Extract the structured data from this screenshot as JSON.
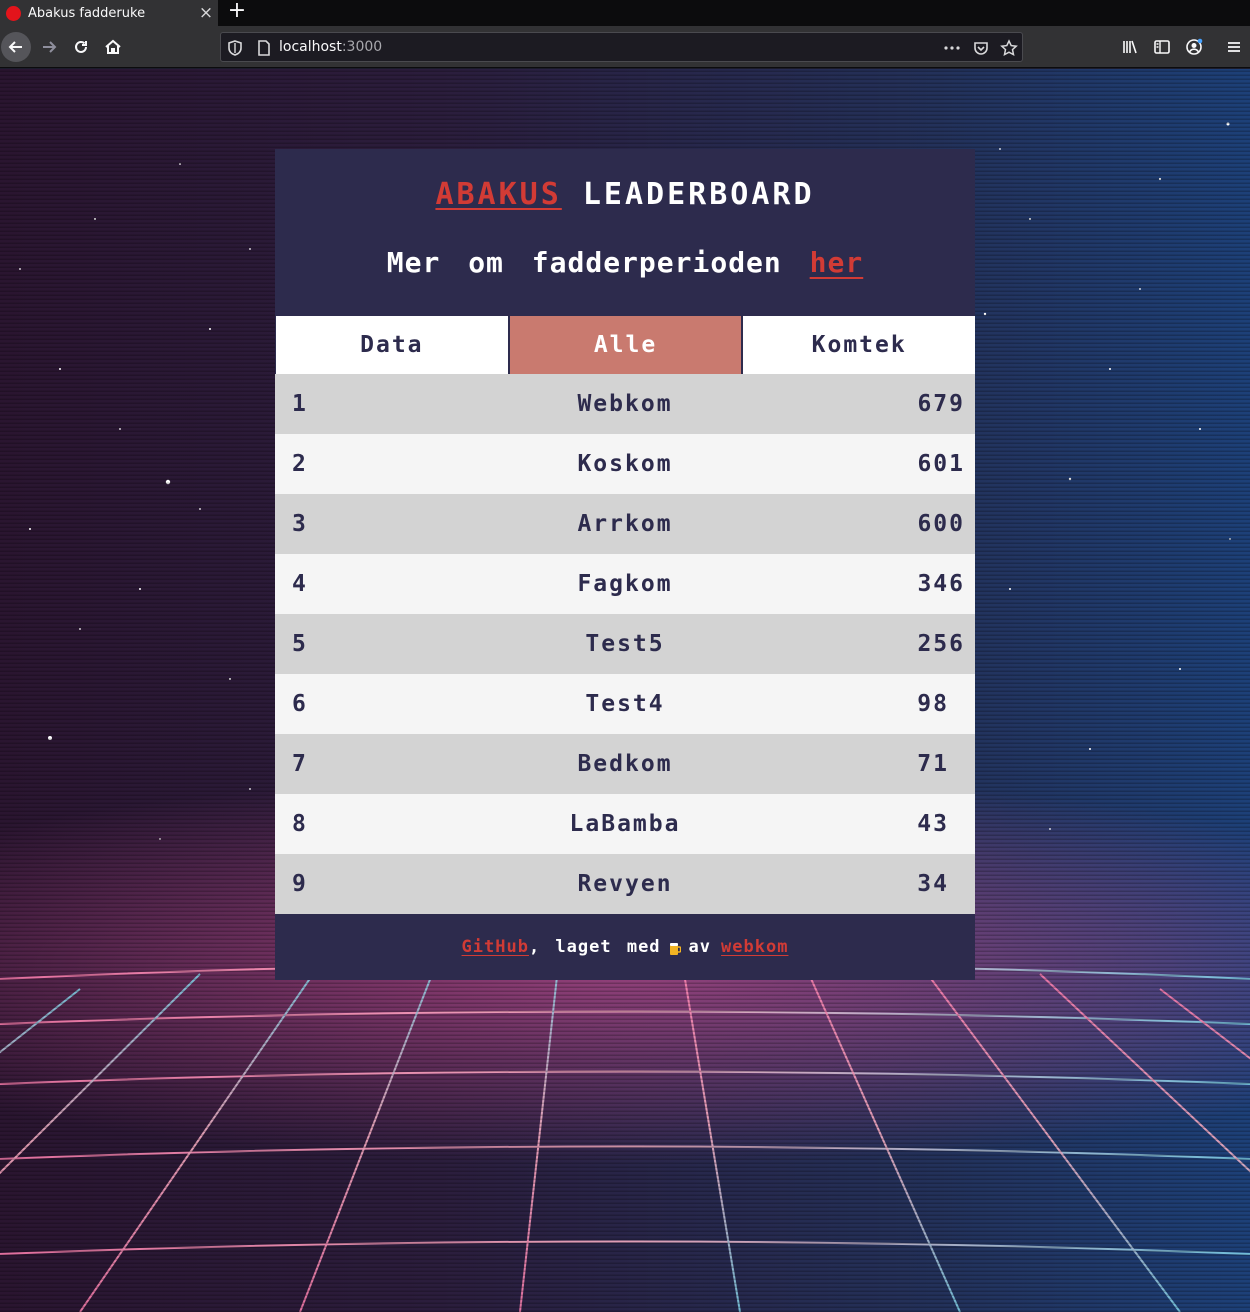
{
  "browser": {
    "tab_title": "Abakus fadderuke",
    "url_host": "localhost",
    "url_port": ":3000",
    "favicon_color": "#e3141b"
  },
  "header": {
    "brand": "ABAKUS",
    "title_rest": "LEADERBOARD",
    "subtitle_prefix": "Mer om fadderperioden",
    "subtitle_link": "her"
  },
  "tabs": [
    {
      "label": "Data",
      "active": false
    },
    {
      "label": "Alle",
      "active": true
    },
    {
      "label": "Komtek",
      "active": false
    }
  ],
  "leaderboard": [
    {
      "rank": "1",
      "name": "Webkom",
      "score": "679"
    },
    {
      "rank": "2",
      "name": "Koskom",
      "score": "601"
    },
    {
      "rank": "3",
      "name": "Arrkom",
      "score": "600"
    },
    {
      "rank": "4",
      "name": "Fagkom",
      "score": "346"
    },
    {
      "rank": "5",
      "name": "Test5",
      "score": "256"
    },
    {
      "rank": "6",
      "name": "Test4",
      "score": "98"
    },
    {
      "rank": "7",
      "name": "Bedkom",
      "score": "71"
    },
    {
      "rank": "8",
      "name": "LaBamba",
      "score": "43"
    },
    {
      "rank": "9",
      "name": "Revyen",
      "score": "34"
    }
  ],
  "footer": {
    "github": "GitHub",
    "made_with": ", laget med",
    "emoji": "beer-icon",
    "by": "av",
    "author": "webkom"
  },
  "colors": {
    "card_bg": "#2d2b4d",
    "accent_red": "#d23b35",
    "active_tab": "#c97a6f",
    "row_odd": "#d3d3d3",
    "row_even": "#f5f5f5"
  }
}
